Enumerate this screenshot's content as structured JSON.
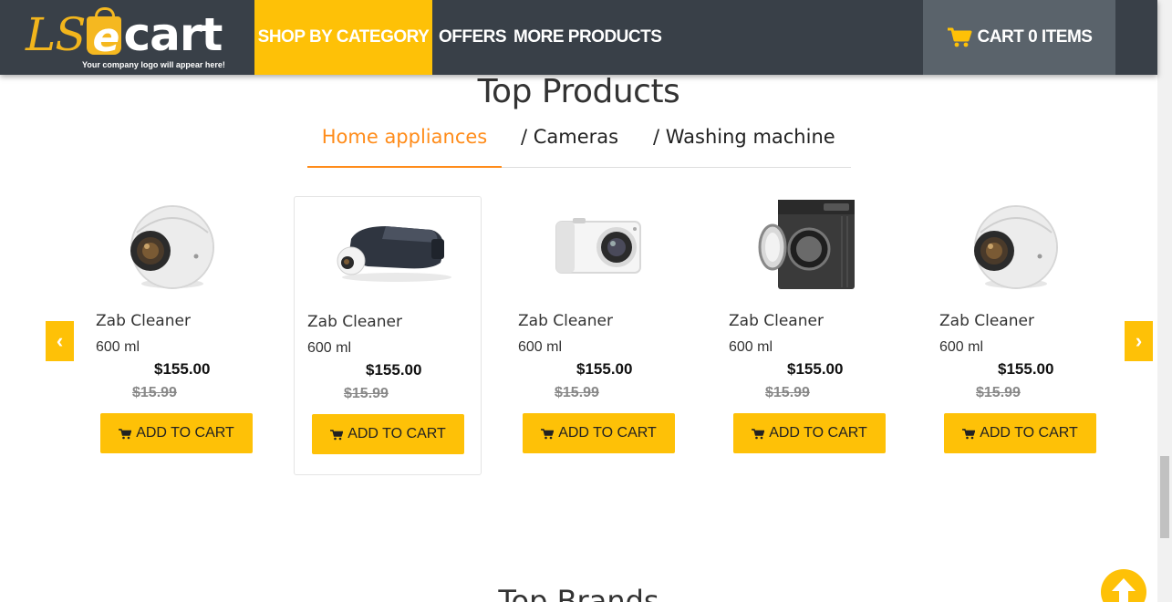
{
  "header": {
    "logo_main": "cart",
    "logo_prefix": "LS",
    "logo_e": "e",
    "logo_tagline": "Your company logo will appear here!",
    "nav": [
      "SHOP BY CATEGORY",
      "OFFERS",
      "MORE PRODUCTS"
    ],
    "cart_label": "CART 0 ITEMS",
    "colors": {
      "bar": "#394048",
      "accent": "#fec107",
      "cart_box": "#5a636b"
    }
  },
  "section": {
    "title": "Top Products",
    "tabs": [
      "Home appliances",
      "/ Cameras",
      "/ Washing machine"
    ],
    "active_tab_color": "#ff8c1a"
  },
  "products": [
    {
      "name": "Zab Cleaner",
      "size": "600 ml",
      "price": "$155.00",
      "old_price": "$15.99",
      "button": "ADD TO CART",
      "image": "360-camera"
    },
    {
      "name": "Zab Cleaner",
      "size": "600 ml",
      "price": "$155.00",
      "old_price": "$15.99",
      "button": "ADD TO CART",
      "image": "vr-headset"
    },
    {
      "name": "Zab Cleaner",
      "size": "600 ml",
      "price": "$155.00",
      "old_price": "$15.99",
      "button": "ADD TO CART",
      "image": "compact-camera"
    },
    {
      "name": "Zab Cleaner",
      "size": "600 ml",
      "price": "$155.00",
      "old_price": "$15.99",
      "button": "ADD TO CART",
      "image": "washing-machine"
    },
    {
      "name": "Zab Cleaner",
      "size": "600 ml",
      "price": "$155.00",
      "old_price": "$15.99",
      "button": "ADD TO CART",
      "image": "360-camera"
    }
  ],
  "carousel": {
    "prev": "‹",
    "next": "›"
  },
  "next_section_title": "Top Brands"
}
